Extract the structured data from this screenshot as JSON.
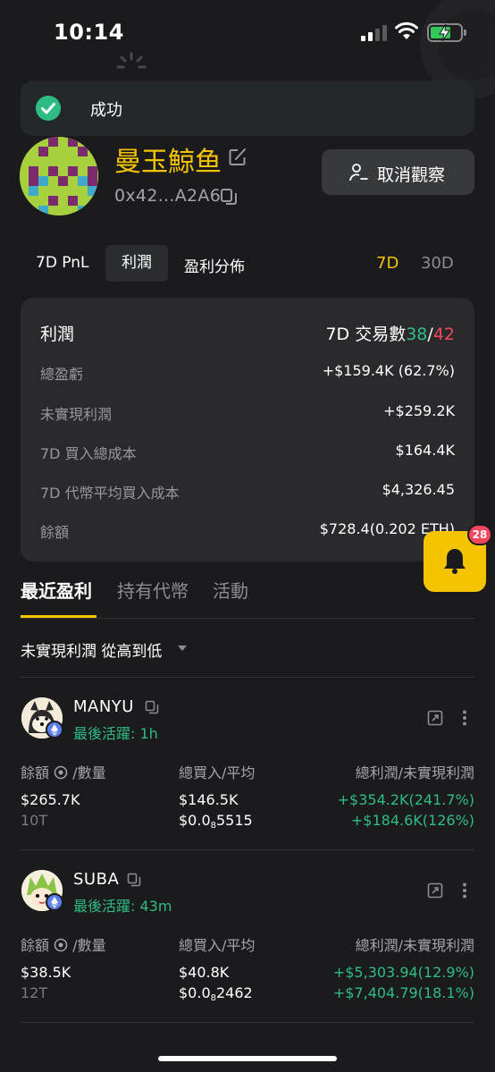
{
  "status": {
    "time": "10:14"
  },
  "toast": {
    "text": "成功"
  },
  "profile": {
    "name": "曼玉鯨鱼",
    "address": "0x42...A2A6",
    "unwatch_label": "取消觀察"
  },
  "tabs": {
    "pnl": "7D PnL",
    "profit": "利潤",
    "distribution": "盈利分佈",
    "range_7d": "7D",
    "range_30d": "30D"
  },
  "card": {
    "title": "利潤",
    "trades_label": "7D 交易數",
    "trades_win": "38",
    "trades_sep": "/",
    "trades_loss": "42",
    "rows": [
      {
        "label": "總盈虧",
        "value": "+$159.4K (62.7%)"
      },
      {
        "label": "未實現利潤",
        "value": "+$259.2K"
      },
      {
        "label": "7D 買入總成本",
        "value": "$164.4K"
      },
      {
        "label": "7D 代幣平均買入成本",
        "value": "$4,326.45"
      },
      {
        "label": "餘額",
        "value": "$728.4(0.202 ETH)"
      }
    ]
  },
  "bell": {
    "badge": "28"
  },
  "section_tabs": {
    "recent": "最近盈利",
    "holdings": "持有代幣",
    "activity": "活動"
  },
  "sort": {
    "label": "未實現利潤 從高到低"
  },
  "columns": {
    "balance": "餘額",
    "qty": "/數量",
    "bought": "總買入/平均",
    "pnl": "總利潤/未實現利潤"
  },
  "tokens": [
    {
      "name": "MANYU",
      "active": "最後活躍: 1h",
      "balance": "$265.7K",
      "qty": "10T",
      "bought": "$146.5K",
      "avg_prefix": "$0.0",
      "avg_sub": "8",
      "avg_rest": "5515",
      "total_pnl": "+$354.2K(241.7%)",
      "unrealized": "+$184.6K(126%)"
    },
    {
      "name": "SUBA",
      "active": "最後活躍: 43m",
      "balance": "$38.5K",
      "qty": "12T",
      "bought": "$40.8K",
      "avg_prefix": "$0.0",
      "avg_sub": "8",
      "avg_rest": "2462",
      "total_pnl": "+$5,303.94(12.9%)",
      "unrealized": "+$7,404.79(18.1%)"
    }
  ],
  "colors": {
    "accent": "#f5c400",
    "positive": "#2ebd85",
    "negative": "#f6465d",
    "background": "#1b1b1d",
    "card": "#2a2a2c"
  }
}
